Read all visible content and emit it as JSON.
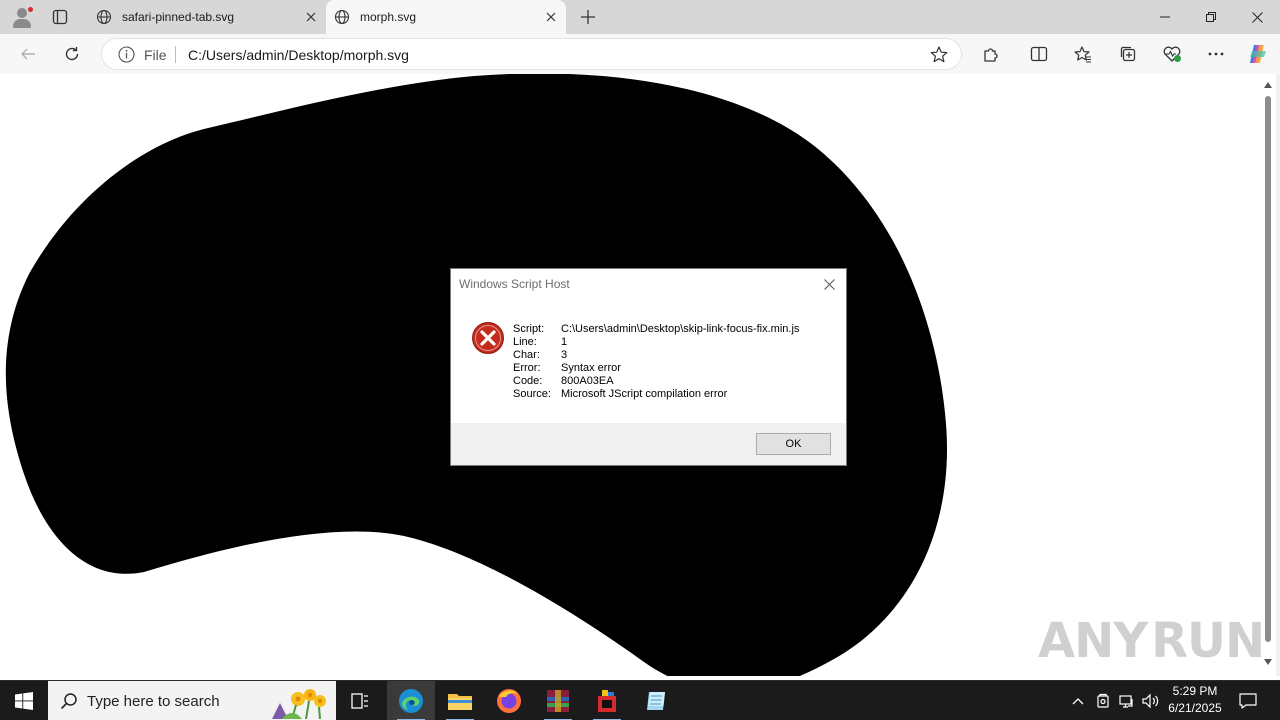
{
  "browser": {
    "tabs": [
      {
        "title": "safari-pinned-tab.svg",
        "active": false
      },
      {
        "title": "morph.svg",
        "active": true
      }
    ],
    "address": {
      "scheme_label": "File",
      "url": "C:/Users/admin/Desktop/morph.svg"
    },
    "icons": {
      "profile": "profile-icon",
      "tab_actions": "tab-actions-icon",
      "back": "back-arrow-icon",
      "reload": "reload-icon",
      "info": "info-icon",
      "favorite_add": "star-outline-icon",
      "extensions": "puzzle-icon",
      "split_screen": "split-screen-icon",
      "favorites": "favorites-icon",
      "collections": "collections-icon",
      "browser_essentials": "heart-pulse-icon",
      "more": "ellipsis-icon",
      "copilot": "copilot-icon"
    }
  },
  "page": {
    "shape_color": "#000000",
    "watermark": {
      "left": "ANY",
      "right": "RUN"
    }
  },
  "dialog": {
    "title": "Windows Script Host",
    "fields": [
      {
        "key": "Script:",
        "value": "C:\\Users\\admin\\Desktop\\skip-link-focus-fix.min.js"
      },
      {
        "key": "Line:",
        "value": "1"
      },
      {
        "key": "Char:",
        "value": "3"
      },
      {
        "key": "Error:",
        "value": "Syntax error"
      },
      {
        "key": "Code:",
        "value": "800A03EA"
      },
      {
        "key": "Source:",
        "value": "Microsoft JScript compilation error"
      }
    ],
    "ok_label": "OK",
    "icon": "error-icon",
    "error_color": "#c42b1c"
  },
  "taskbar": {
    "search_placeholder": "Type here to search",
    "apps": [
      "task-view-icon",
      "edge-icon",
      "file-explorer-icon",
      "firefox-icon",
      "winrar-icon",
      "media-app-icon",
      "notepad-icon"
    ],
    "clock": {
      "time": "5:29 PM",
      "date": "6/21/2025"
    }
  }
}
